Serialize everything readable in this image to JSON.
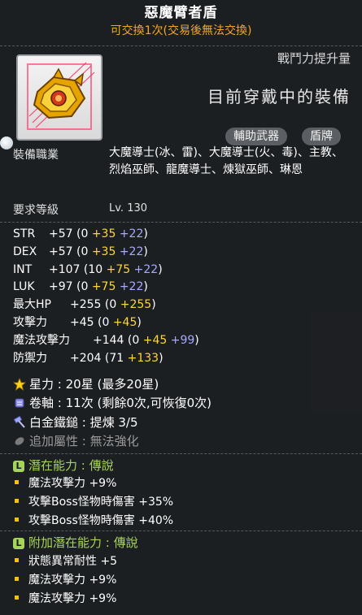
{
  "item": {
    "name": "惡魔臂者盾",
    "trade_note": "可交換1次(交易後無法交換)"
  },
  "combat_power_label": "戰鬥力提升量",
  "equipped_label": "目前穿戴中的裝備",
  "tags": [
    "輔助武器",
    "盾牌"
  ],
  "jobs": {
    "label": "裝備職業",
    "text": "大魔導士(冰、雷)、大魔導士(火、毒)、主教、烈焰巫師、龍魔導士、煉獄巫師、琳恩"
  },
  "required_level": {
    "label": "要求等級",
    "value": "Lv. 130"
  },
  "stats": [
    {
      "name": "STR",
      "total": "+57",
      "base": "(0 ",
      "plus1": "+35",
      "plus2": " +22",
      "close": ")"
    },
    {
      "name": "DEX",
      "total": "+57",
      "base": "(0 ",
      "plus1": "+35",
      "plus2": " +22",
      "close": ")"
    },
    {
      "name": "INT",
      "total": "+107",
      "base": "(10 ",
      "plus1": "+75",
      "plus2": " +22",
      "close": ")"
    },
    {
      "name": "LUK",
      "total": "+97",
      "base": "(0 ",
      "plus1": "+75",
      "plus2": " +22",
      "close": ")"
    },
    {
      "name": "最大HP",
      "total": "+255",
      "base": "(0 ",
      "plus1": "+255",
      "plus2": "",
      "close": ")"
    },
    {
      "name": "攻擊力",
      "total": "+45",
      "base": "(0 ",
      "plus1": "+45",
      "plus2": "",
      "close": ")"
    },
    {
      "name": "魔法攻擊力",
      "total": "+144",
      "base": "(0 ",
      "plus1": "+45",
      "plus2": " +99",
      "close": ")"
    },
    {
      "name": "防禦力",
      "total": "+204",
      "base": "(71 ",
      "plus1": "+133",
      "plus2": "",
      "close": ")"
    }
  ],
  "star_force": {
    "label": "星力",
    "value": "20星 (最多20星)"
  },
  "scroll": {
    "label": "卷軸",
    "value": "11次 (剩餘0次,可恢復0次)"
  },
  "platinum_hammer": {
    "label": "白金鐵鎚",
    "value": "提煉 3/5"
  },
  "additional_option": {
    "label": "追加屬性",
    "value": "無法強化"
  },
  "potential": {
    "badge": "L",
    "label": "潛在能力",
    "grade": "傳說",
    "lines": [
      "魔法攻擊力 +9%",
      "攻擊Boss怪物時傷害 +35%",
      "攻擊Boss怪物時傷害 +40%"
    ]
  },
  "bonus_potential": {
    "badge": "L",
    "label": "附加潛在能力",
    "grade": "傳說",
    "lines": [
      "狀態異常耐性 +5",
      "魔法攻擊力 +9%",
      "魔法攻擊力 +9%"
    ]
  },
  "colors": {
    "trade": "#f5a623",
    "upgrade_yellow": "#ffd633",
    "upgrade_blue": "#a8aaff",
    "legendary_green": "#a6d45a",
    "bullet": "#f5c400"
  }
}
